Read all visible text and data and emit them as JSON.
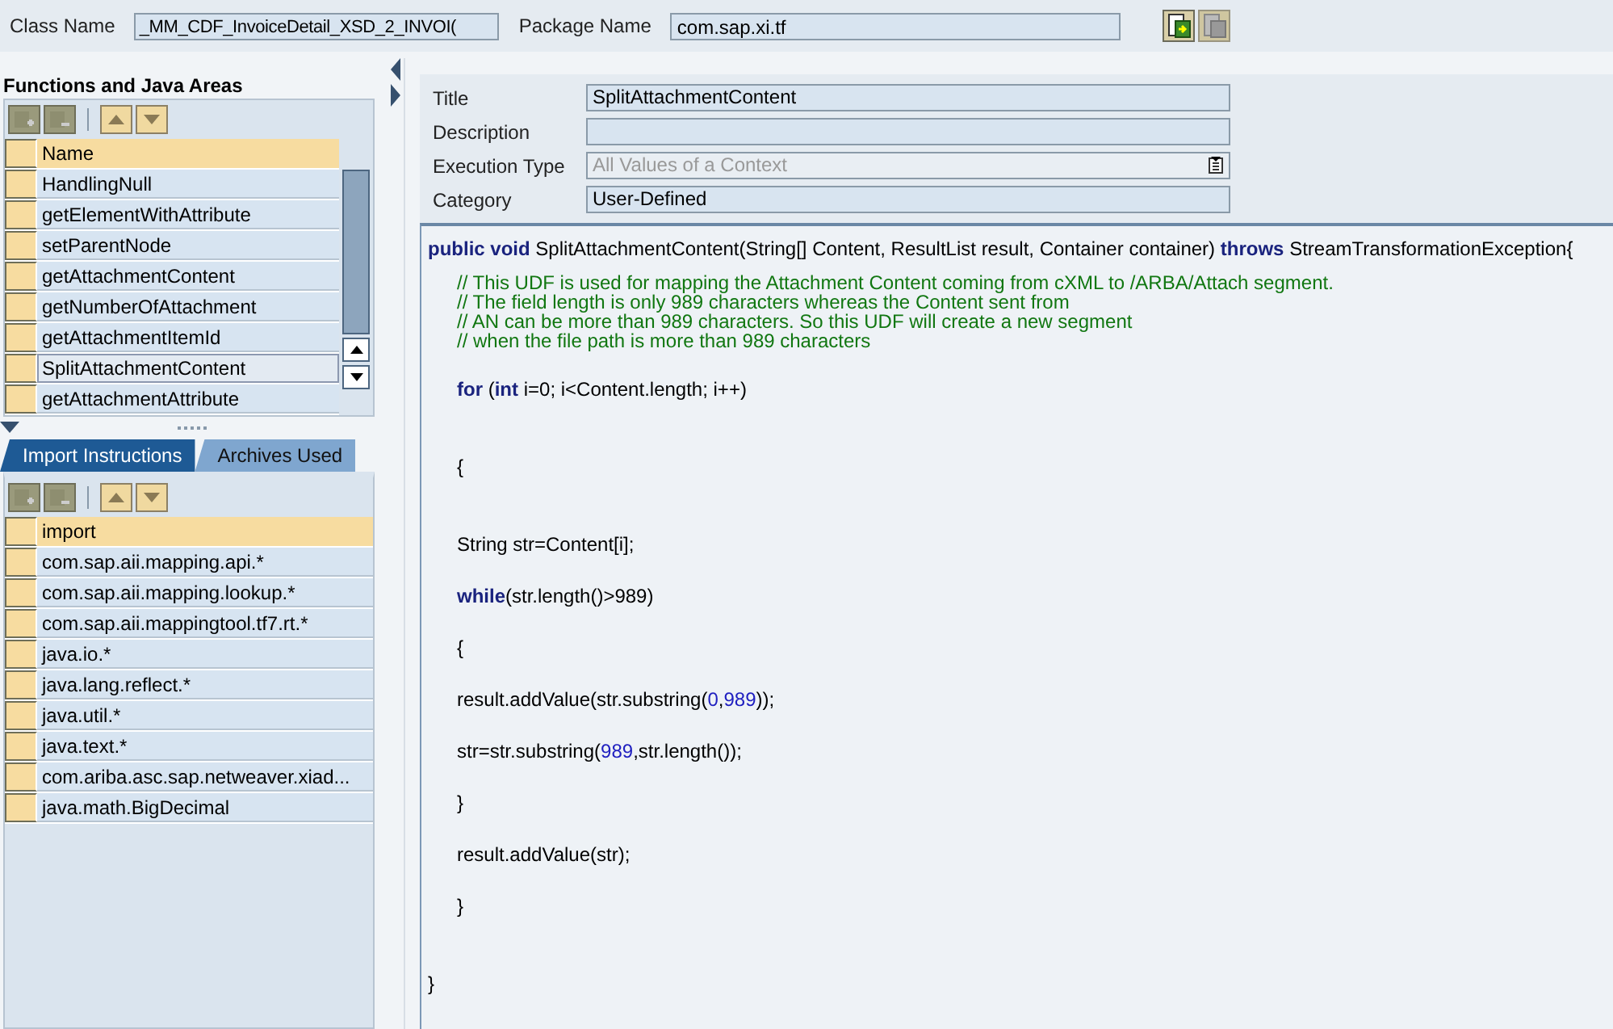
{
  "header": {
    "class_name_label": "Class Name",
    "class_name": "_MM_CDF_InvoiceDetail_XSD_2_INVOI(",
    "package_name_label": "Package Name",
    "package_name": "com.sap.xi.tf"
  },
  "functions": {
    "title": "Functions and Java Areas",
    "column": "Name",
    "items": [
      {
        "name": "HandlingNull",
        "selected": false
      },
      {
        "name": "getElementWithAttribute",
        "selected": false
      },
      {
        "name": "setParentNode",
        "selected": false
      },
      {
        "name": "getAttachmentContent",
        "selected": false
      },
      {
        "name": "getNumberOfAttachment",
        "selected": false
      },
      {
        "name": "getAttachmentItemId",
        "selected": false
      },
      {
        "name": "SplitAttachmentContent",
        "selected": true
      },
      {
        "name": "getAttachmentAttribute",
        "selected": false
      }
    ]
  },
  "tabs": [
    {
      "label": "Import Instructions",
      "selected": true
    },
    {
      "label": "Archives Used",
      "selected": false
    }
  ],
  "imports": {
    "column": "import",
    "items": [
      "com.sap.aii.mapping.api.*",
      "com.sap.aii.mapping.lookup.*",
      "com.sap.aii.mappingtool.tf7.rt.*",
      "java.io.*",
      "java.lang.reflect.*",
      "java.util.*",
      "java.text.*",
      "com.ariba.asc.sap.netweaver.xiad...",
      "java.math.BigDecimal"
    ]
  },
  "properties": [
    {
      "label": "Title",
      "value": "SplitAttachmentContent",
      "kind": "text",
      "disabled": false
    },
    {
      "label": "Description",
      "kind": "text",
      "disabled": false
    },
    {
      "label": "Execution Type",
      "value": "All Values of a Context",
      "kind": "dropdown",
      "disabled": true
    },
    {
      "label": "Category",
      "value": "User-Defined",
      "kind": "text",
      "disabled": false
    }
  ],
  "code": [
    {
      "kind": "code",
      "indented": false,
      "tokens": [
        {
          "text": "public void",
          "kind": "keyword"
        },
        {
          "text": " SplitAttachmentContent(String[] Content, ResultList result, Container container) ",
          "kind": "plain"
        },
        {
          "text": "throws",
          "kind": "keyword"
        },
        {
          "text": " StreamTransformationException{",
          "kind": "plain"
        }
      ]
    },
    {
      "kind": "comment",
      "indented": true,
      "tokens": [
        {
          "text": "// This UDF is used for mapping the Attachment Content coming from cXML to /ARBA/Attach segment.",
          "kind": "comment"
        }
      ]
    },
    {
      "kind": "comment",
      "indented": true,
      "tokens": [
        {
          "text": "// The field length is only 989 characters whereas the Content sent from",
          "kind": "comment"
        }
      ]
    },
    {
      "kind": "comment",
      "indented": true,
      "tokens": [
        {
          "text": "// AN can be more than 989 characters. So this UDF will create a new segment",
          "kind": "comment"
        }
      ]
    },
    {
      "kind": "comment",
      "indented": true,
      "tokens": [
        {
          "text": "// when the file path is more than 989 characters",
          "kind": "comment"
        }
      ]
    },
    {
      "kind": "blank"
    },
    {
      "kind": "code",
      "indented": true,
      "tokens": [
        {
          "text": "for",
          "kind": "keyword"
        },
        {
          "text": " (",
          "kind": "plain"
        },
        {
          "text": "int",
          "kind": "keyword"
        },
        {
          "text": " i=0; i<Content.length; i++)",
          "kind": "plain"
        }
      ]
    },
    {
      "kind": "blank"
    },
    {
      "kind": "blank"
    },
    {
      "kind": "code",
      "indented": true,
      "tokens": [
        {
          "text": "{",
          "kind": "plain"
        }
      ]
    },
    {
      "kind": "blank"
    },
    {
      "kind": "blank"
    },
    {
      "kind": "code",
      "indented": true,
      "tokens": [
        {
          "text": "String str=Content[i];",
          "kind": "plain"
        }
      ]
    },
    {
      "kind": "blank"
    },
    {
      "kind": "code",
      "indented": true,
      "tokens": [
        {
          "text": "while",
          "kind": "keyword"
        },
        {
          "text": "(str.length()>989)",
          "kind": "plain"
        }
      ]
    },
    {
      "kind": "blank"
    },
    {
      "kind": "code",
      "indented": true,
      "tokens": [
        {
          "text": "{",
          "kind": "plain"
        }
      ]
    },
    {
      "kind": "blank"
    },
    {
      "kind": "code",
      "indented": true,
      "tokens": [
        {
          "text": "result.addValue(str.substring(",
          "kind": "plain"
        },
        {
          "text": "0",
          "kind": "number"
        },
        {
          "text": ",",
          "kind": "plain"
        },
        {
          "text": "989",
          "kind": "number"
        },
        {
          "text": "));",
          "kind": "plain"
        }
      ]
    },
    {
      "kind": "blank"
    },
    {
      "kind": "code",
      "indented": true,
      "tokens": [
        {
          "text": "str=str.substring(",
          "kind": "plain"
        },
        {
          "text": "989",
          "kind": "number"
        },
        {
          "text": ",str.length());",
          "kind": "plain"
        }
      ]
    },
    {
      "kind": "blank"
    },
    {
      "kind": "code",
      "indented": true,
      "tokens": [
        {
          "text": "}",
          "kind": "plain"
        }
      ]
    },
    {
      "kind": "blank"
    },
    {
      "kind": "code",
      "indented": true,
      "tokens": [
        {
          "text": "result.addValue(str);",
          "kind": "plain"
        }
      ]
    },
    {
      "kind": "blank"
    },
    {
      "kind": "code",
      "indented": true,
      "tokens": [
        {
          "text": "}",
          "kind": "plain"
        }
      ]
    },
    {
      "kind": "blank"
    },
    {
      "kind": "blank"
    },
    {
      "kind": "code",
      "indented": false,
      "tokens": [
        {
          "text": "}",
          "kind": "plain"
        }
      ]
    }
  ]
}
